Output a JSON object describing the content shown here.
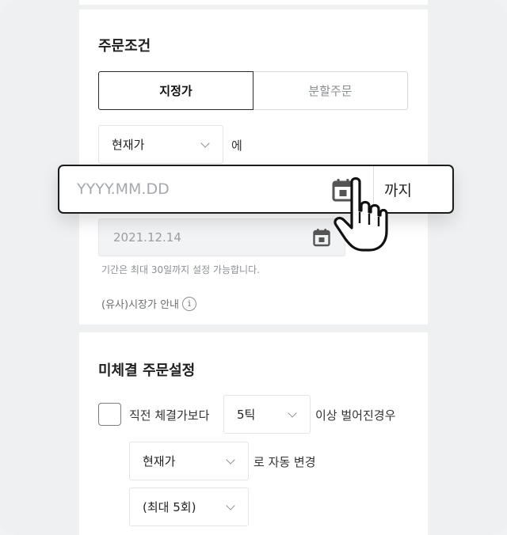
{
  "order_conditions": {
    "title": "주문조건",
    "tabs": [
      {
        "label": "지정가",
        "active": true
      },
      {
        "label": "분할주문",
        "active": false
      }
    ],
    "price_basis_select": "현재가",
    "price_basis_suffix": "에",
    "date_popup": {
      "placeholder": "YYYY.MM.DD",
      "suffix": "까지"
    },
    "date_disabled_value": "2021.12.14",
    "hint": "기간은 최대 30일까지 설정 가능합니다.",
    "info_link": "(유사)시장가 안내",
    "info_icon": "i"
  },
  "unfilled_settings": {
    "title": "미체결 주문설정",
    "checkbox_label_prefix": "직전 체결가보다",
    "tick_select": "5틱",
    "checkbox_label_suffix": "이상 벌어진경우",
    "change_select": "현재가",
    "change_suffix": "로 자동 변경",
    "max_select": "(최대 5회)"
  },
  "colors": {
    "accent_border": "#1c1c1c",
    "muted_text": "#8c8f94",
    "background": "#eef0f2"
  }
}
